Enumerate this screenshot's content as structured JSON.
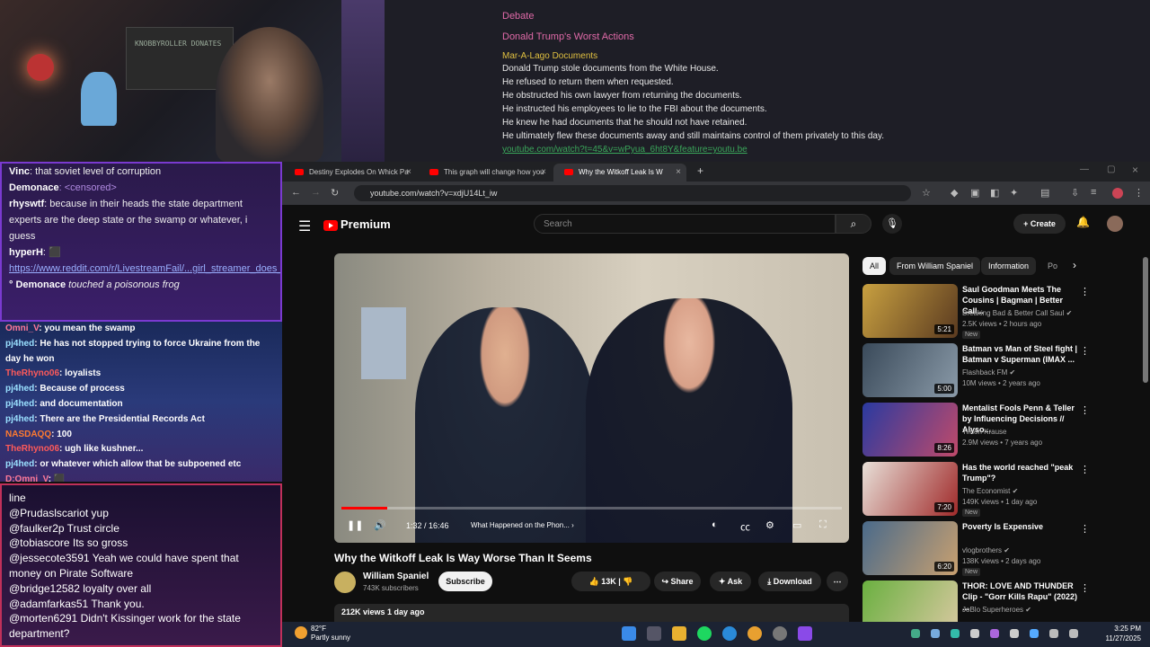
{
  "webcam": {
    "shelf_text": "KNOBBYROLLER DONATES"
  },
  "notes": {
    "heading": "Debate",
    "subheading": "Donald Trump's Worst Actions",
    "section": "Mar-A-Lago Documents",
    "lines": [
      "Donald Trump stole documents from the White House.",
      "He refused to return them when requested.",
      "He obstructed his own lawyer from returning the documents.",
      "He instructed his employees to lie to the FBI about the documents.",
      "He knew he had documents that he should not have retained.",
      "He ultimately flew these documents away and still maintains control of them privately to this day."
    ],
    "link": "youtube.com/watch?t=45&v=wPyua_6ht8Y&feature=youtu.be"
  },
  "chat1": [
    {
      "user": "Vinc",
      "text": ": that soviet level of corruption",
      "ucolor": "#ffffff"
    },
    {
      "user": "Demonace",
      "text": ":   <censored>",
      "ucolor": "#ffffff",
      "tcolor": "#b08ae0"
    },
    {
      "user": "rhyswtf",
      "text": ": because in their heads the state department experts are the deep state or the swamp or whatever, i guess",
      "ucolor": "#ffffff"
    },
    {
      "user": "hyperH",
      "text": ":   ⬛",
      "ucolor": "#ffffff"
    },
    {
      "user": "",
      "text": "https://www.reddit.com/r/LivestreamFail/...girl_streamer_does_the_pokimane_classic/",
      "tcolor": "#9ab0ff",
      "underline": true
    },
    {
      "user": "° Demonace",
      "text": " touched a poisonous frog",
      "ucolor": "#ffffff",
      "italic": true
    }
  ],
  "chat2": [
    {
      "user": "Omni_V",
      "text": ": you mean the swamp",
      "ucolor": "#ff7a9a"
    },
    {
      "user": "pj4hed",
      "text": ": He has not stopped trying to force Ukraine from the",
      "ucolor": "#9ae0ff"
    },
    {
      "user": "",
      "text": "day he won",
      "ucolor": "#fff"
    },
    {
      "user": "TheRhyno06",
      "text": ": loyalists",
      "ucolor": "#ff5a5a"
    },
    {
      "user": "pj4hed",
      "text": ": Because of process",
      "ucolor": "#9ae0ff"
    },
    {
      "user": "pj4hed",
      "text": ": and documentation",
      "ucolor": "#9ae0ff"
    },
    {
      "user": "pj4hed",
      "text": ": There are the Presidential Records Act",
      "ucolor": "#9ae0ff"
    },
    {
      "user": "NASDAQQ",
      "text": ": 100",
      "ucolor": "#ff7a30"
    },
    {
      "user": "TheRhyno06",
      "text": ": ugh like kushner...",
      "ucolor": "#ff5a5a"
    },
    {
      "user": "pj4hed",
      "text": ": or whatever which allow that be subpoened etc",
      "ucolor": "#9ae0ff"
    },
    {
      "user": "D:Omni_V",
      "text": ": ⬛",
      "ucolor": "#ff7a9a"
    }
  ],
  "chat3": [
    {
      "user": "",
      "text": "line"
    },
    {
      "user": "@Prudaslscariot",
      "text": " yup"
    },
    {
      "user": "@faulker2p",
      "text": " Trust circle"
    },
    {
      "user": "@tobiascore",
      "text": " Its so gross"
    },
    {
      "user": "@jessecote3591",
      "text": " Yeah we could have spent that money on Pirate Software"
    },
    {
      "user": "@bridge12582",
      "text": " loyalty over all"
    },
    {
      "user": "@adamfarkas51",
      "text": " Thank you."
    },
    {
      "user": "@morten6291",
      "text": " Didn't Kissinger work for the state department?"
    }
  ],
  "browser": {
    "tabs": [
      {
        "label": "Destiny Explodes On Whick Pa"
      },
      {
        "label": "This graph will change how you"
      },
      {
        "label": "Why the Witkoff Leak Is W"
      }
    ],
    "new_tab": "+",
    "url": "youtube.com/watch?v=xdjU14Lt_iw"
  },
  "youtube": {
    "logo": "Premium",
    "search_placeholder": "Search",
    "create_label": "Create",
    "time": "1:32 / 16:46",
    "chapter": "What Happened on the Phon... ›",
    "progress": 0.092,
    "title": "Why the Witkoff Leak Is Way Worse Than It Seems",
    "channel": "William Spaniel",
    "subs": "743K subscribers",
    "subscribe": "Subscribe",
    "likes": "13K",
    "share": "Share",
    "ask": "Ask",
    "download": "Download",
    "desc": "212K views  1 day ago",
    "chips": [
      "All",
      "From William Spaniel",
      "Information",
      "Po"
    ],
    "recs": [
      {
        "title": "Saul Goodman Meets The Cousins | Bagman | Better Call...",
        "channel": "Breaking Bad & Better Call Saul ✔",
        "views": "2.5K views • 2 hours ago",
        "new": "New",
        "dur": "5:21",
        "c1": "#c8a040",
        "c2": "#5a3a20"
      },
      {
        "title": "Batman vs Man of Steel fight | Batman v Superman (IMAX ...",
        "channel": "Flashback FM ✔",
        "views": "10M views • 2 years ago",
        "new": "",
        "dur": "5:00",
        "c1": "#3a4a5a",
        "c2": "#8a9aa8"
      },
      {
        "title": "Mentalist Fools Penn & Teller by Influencing Decisions // Alyso...",
        "channel": "Timon Krause",
        "views": "2.9M views • 7 years ago",
        "new": "",
        "dur": "8:26",
        "c1": "#2a3aa0",
        "c2": "#c04a6a"
      },
      {
        "title": "Has the world reached \"peak Trump\"?",
        "channel": "The Economist ✔",
        "views": "149K views • 1 day ago",
        "new": "New",
        "dur": "7:20",
        "c1": "#e8e0d8",
        "c2": "#a02a2a"
      },
      {
        "title": "Poverty Is Expensive",
        "channel": "vlogbrothers ✔",
        "views": "138K views • 2 days ago",
        "new": "New",
        "dur": "6:20",
        "c1": "#4a6a8a",
        "c2": "#c8a070"
      },
      {
        "title": "THOR: LOVE AND THUNDER Clip - \"Gorr Kills Rapu\" (2022) ...",
        "channel": "JoBlo Superheroes ✔",
        "views": "",
        "new": "",
        "dur": "",
        "c1": "#6ab040",
        "c2": "#d8c8a0"
      }
    ]
  },
  "taskbar": {
    "temp": "82°F",
    "cond": "Partly sunny",
    "time": "3:25 PM",
    "date": "11/27/2025"
  }
}
